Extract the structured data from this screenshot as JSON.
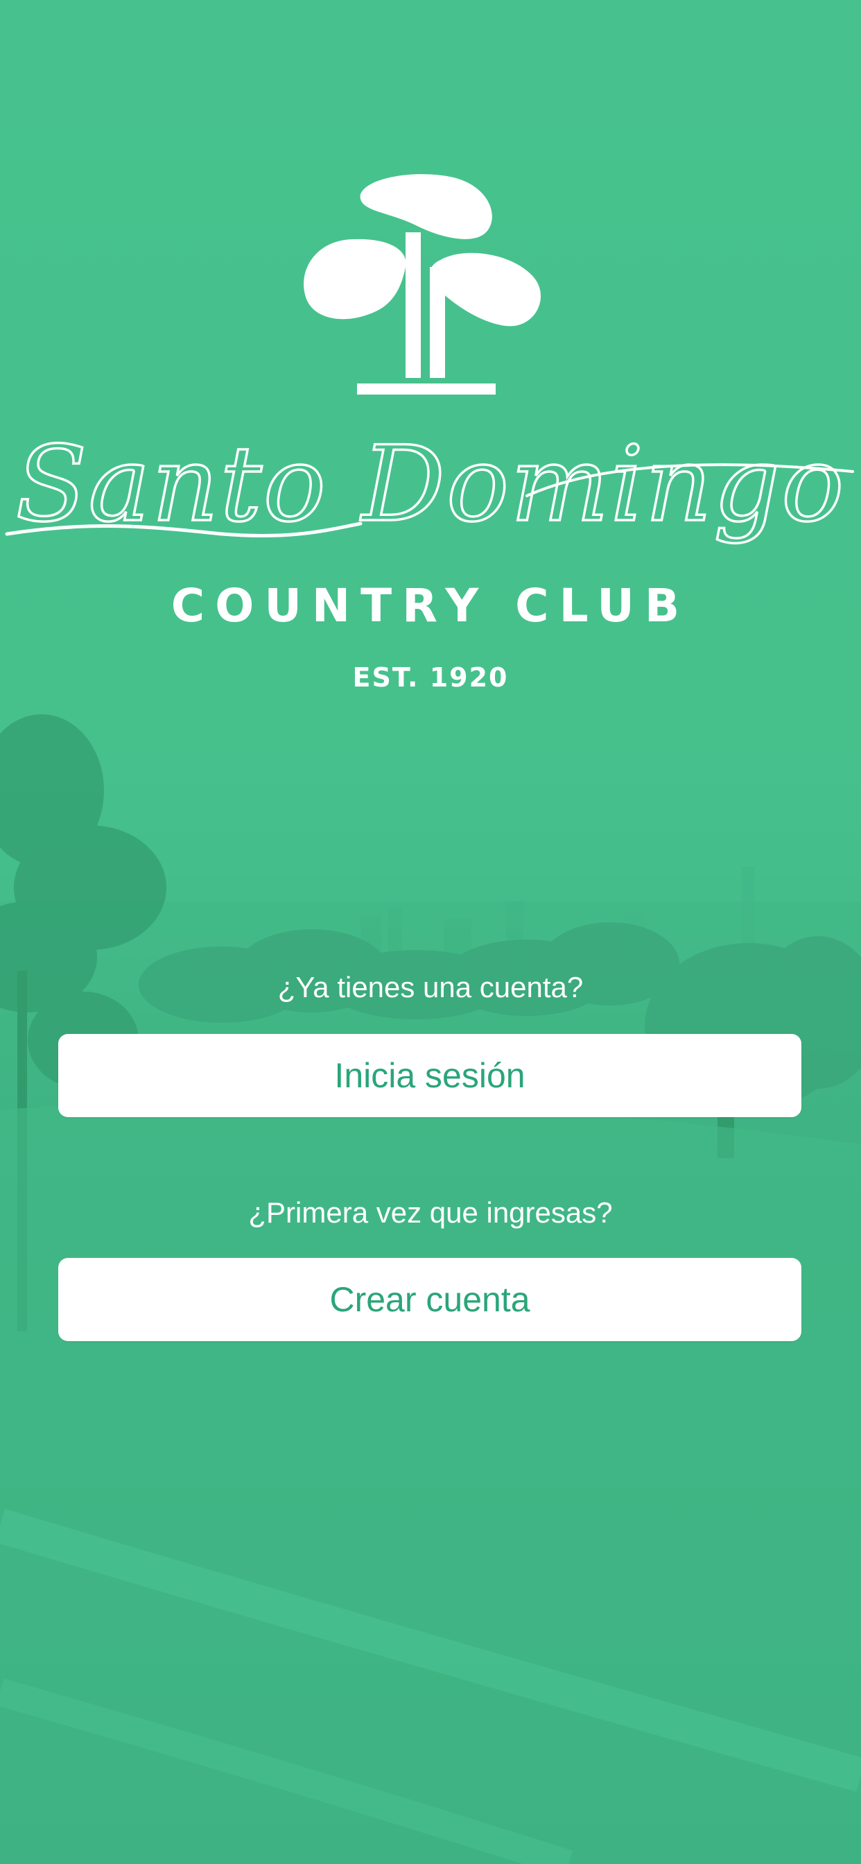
{
  "brand": {
    "script_name": "Santo Domingo",
    "club_name": "COUNTRY CLUB",
    "established": "EST. 1920",
    "logo_icon": "golf-club-tree-icon"
  },
  "login": {
    "prompt": "¿Ya tienes una cuenta?",
    "button_label": "Inicia sesión"
  },
  "signup": {
    "prompt": "¿Primera vez que ingresas?",
    "button_label": "Crear cuenta"
  },
  "colors": {
    "overlay_green": "#46c08c",
    "button_text": "#2aa57a",
    "button_bg": "#ffffff"
  }
}
